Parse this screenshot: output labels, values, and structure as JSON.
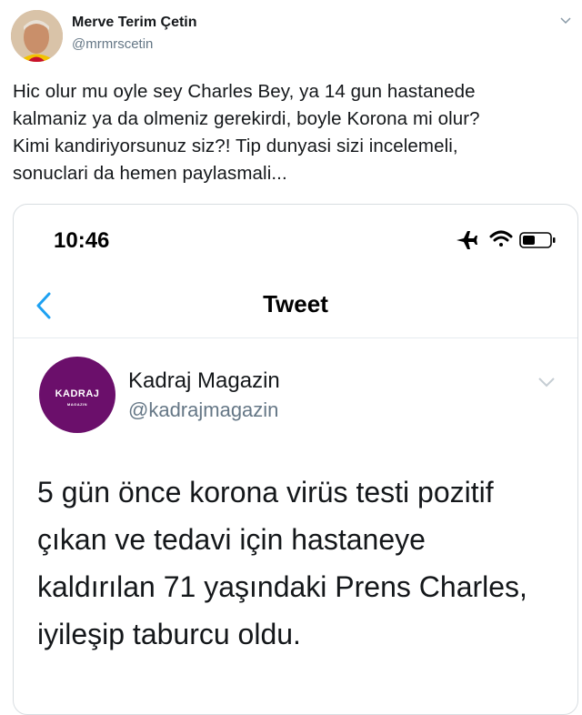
{
  "tweet": {
    "author": {
      "name": "Merve Terim Çetin",
      "handle": "@mrmrscetin"
    },
    "text_lines": [
      "Hic olur mu oyle sey Charles Bey, ya 14 gun hastanede",
      "kalmaniz ya da olmeniz gerekirdi, boyle Korona mi olur?",
      "Kimi kandiriyorsunuz siz?! Tip dunyasi sizi incelemeli,",
      "sonuclari da hemen paylasmali..."
    ]
  },
  "embedded_screenshot": {
    "status_bar": {
      "time": "10:46",
      "icons": [
        "airplane-icon",
        "wifi-icon",
        "battery-icon"
      ]
    },
    "nav": {
      "title": "Tweet",
      "back_icon": "chevron-left-icon"
    },
    "tweet": {
      "author": {
        "name": "Kadraj Magazin",
        "handle": "@kadrajmagazin",
        "avatar_text": "KADRAJ",
        "avatar_subtext": "MAGAZIN"
      },
      "text_lines": [
        "5 gün önce korona virüs testi pozitif",
        "çıkan ve tedavi için hastaneye",
        "kaldırılan 71 yaşındaki Prens Charles,",
        "iyileşip taburcu oldu."
      ]
    }
  },
  "colors": {
    "text": "#14171a",
    "muted": "#657786",
    "link_blue": "#1da1f2",
    "kadraj_purple": "#6b0f6b"
  }
}
